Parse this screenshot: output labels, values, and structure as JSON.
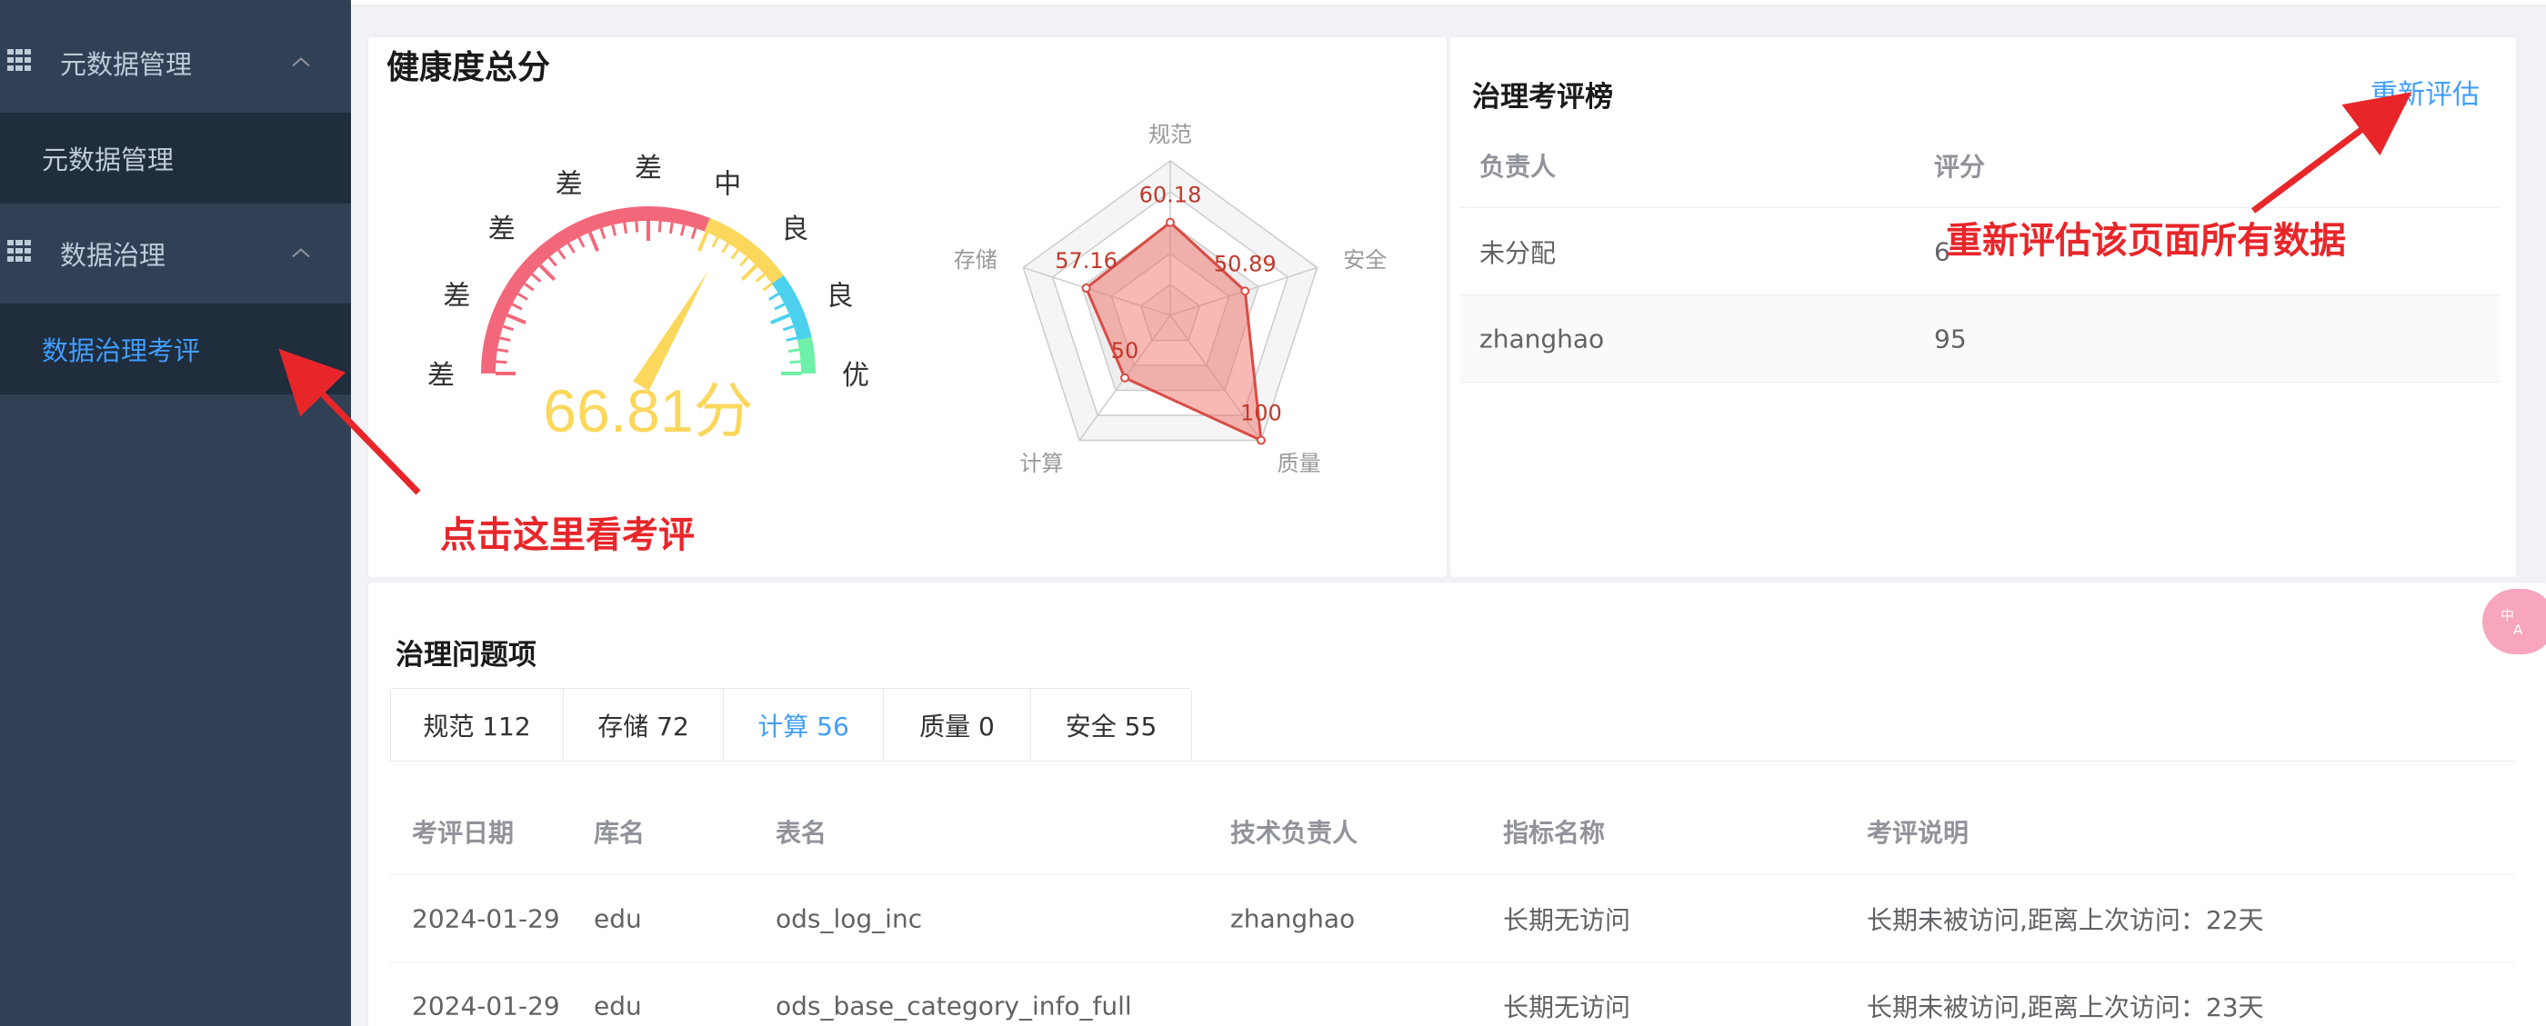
{
  "sidebar": {
    "groups": [
      {
        "label": "元数据管理",
        "icon": "grid-icon"
      },
      {
        "label": "数据治理",
        "icon": "grid-icon"
      }
    ],
    "items": [
      {
        "label": "元数据管理",
        "active": false
      },
      {
        "label": "数据治理考评",
        "active": true
      }
    ]
  },
  "health": {
    "title": "健康度总分",
    "score": 66.81,
    "score_text": "66.81分",
    "gauge_labels": [
      "差",
      "差",
      "差",
      "差",
      "差",
      "中",
      "良",
      "良",
      "优"
    ],
    "gauge_colors": [
      "#f2687a",
      "#fbd75b",
      "#4bd1ee",
      "#6ef0a8"
    ]
  },
  "radar": {
    "axes": [
      "规范",
      "安全",
      "质量",
      "计算",
      "存储"
    ],
    "values": [
      60.18,
      50.89,
      100,
      50,
      57.16
    ],
    "max": 100
  },
  "ranking": {
    "title": "治理考评榜",
    "reevaluate_label": "重新评估",
    "columns": [
      "负责人",
      "评分"
    ],
    "rows": [
      [
        "未分配",
        "6"
      ],
      [
        "zhanghao",
        "95"
      ]
    ]
  },
  "issues": {
    "title": "治理问题项",
    "tabs": [
      {
        "label": "规范 112",
        "active": false
      },
      {
        "label": "存储 72",
        "active": false
      },
      {
        "label": "计算 56",
        "active": true
      },
      {
        "label": "质量 0",
        "active": false
      },
      {
        "label": "安全 55",
        "active": false
      }
    ],
    "columns": [
      "考评日期",
      "库名",
      "表名",
      "技术负责人",
      "指标名称",
      "考评说明"
    ],
    "rows": [
      [
        "2024-01-29",
        "edu",
        "ods_log_inc",
        "zhanghao",
        "长期无访问",
        "长期未被访问,距离上次访问：22天"
      ],
      [
        "2024-01-29",
        "edu",
        "ods_base_category_info_full",
        "",
        "长期无访问",
        "长期未被访问,距离上次访问：23天"
      ]
    ]
  },
  "annotations": {
    "click_here": "点击这里看考评",
    "reevaluate_all": "重新评估该页面所有数据",
    "color": "#e8262a"
  }
}
